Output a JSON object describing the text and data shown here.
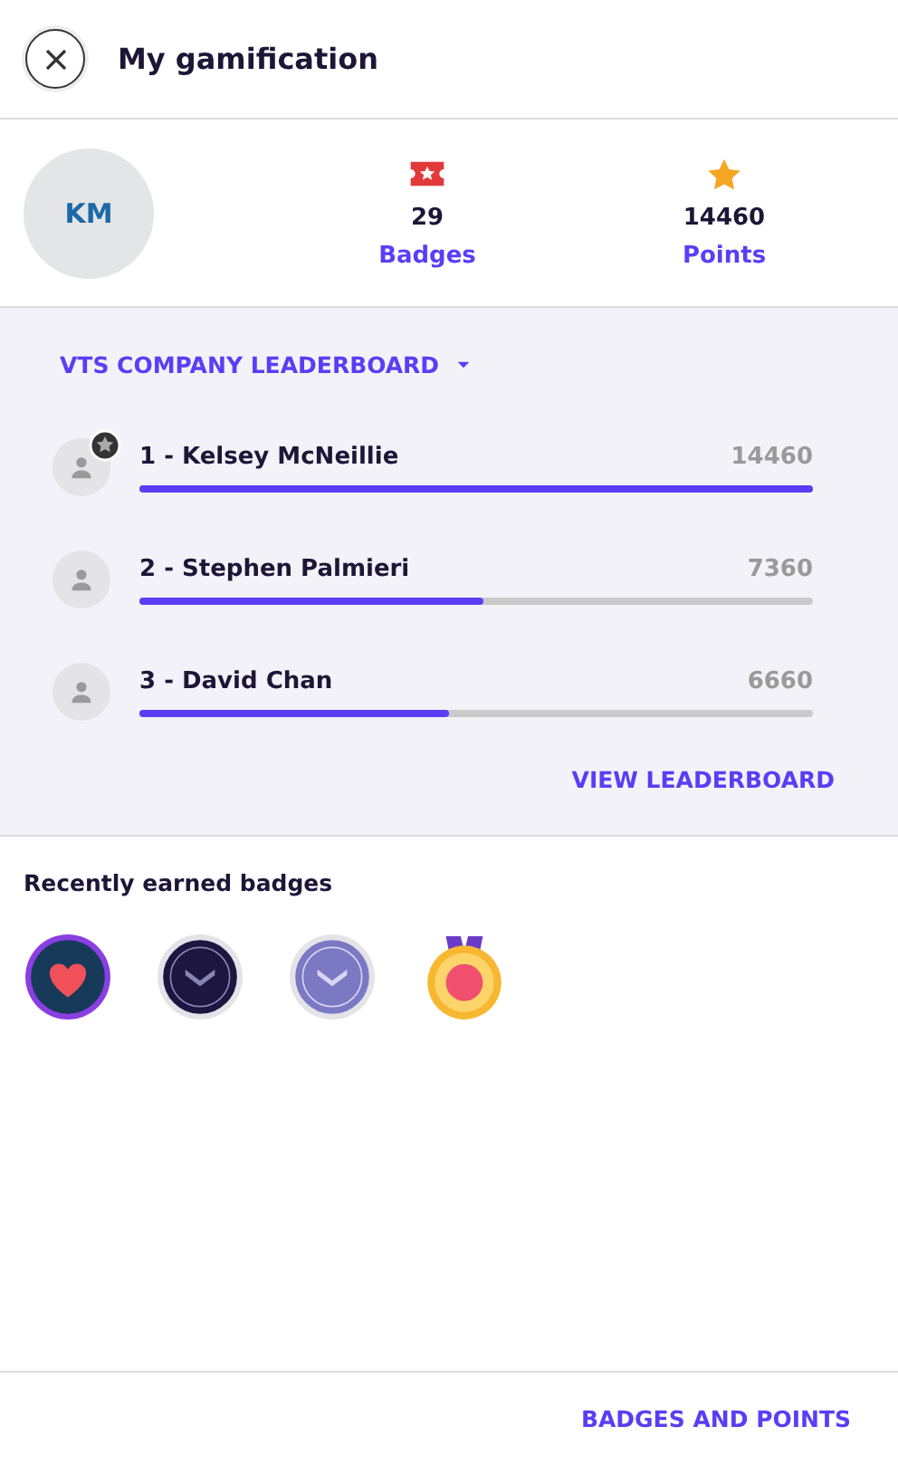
{
  "header": {
    "title": "My gamification"
  },
  "profile": {
    "initials": "KM",
    "stats": [
      {
        "kind": "badge",
        "value": "29",
        "label": "Badges"
      },
      {
        "kind": "star",
        "value": "14460",
        "label": "Points"
      }
    ]
  },
  "leaderboard": {
    "title": "VTS COMPANY LEADERBOARD",
    "entries": [
      {
        "name": "1 - Kelsey McNeillie",
        "points": "14460",
        "level": 1.0,
        "starred": true
      },
      {
        "name": "2 - Stephen Palmieri",
        "points": "7360",
        "level": 0.51,
        "starred": false
      },
      {
        "name": "3 - David Chan",
        "points": "6660",
        "level": 0.46,
        "starred": false
      }
    ],
    "link": "VIEW LEADERBOARD"
  },
  "recent_badges": {
    "title": "Recently earned badges",
    "badges": [
      {
        "kind": "heart"
      },
      {
        "kind": "vts-dark"
      },
      {
        "kind": "vts-light"
      },
      {
        "kind": "medal"
      }
    ]
  },
  "footer": {
    "button": "BADGES AND POINTS"
  }
}
